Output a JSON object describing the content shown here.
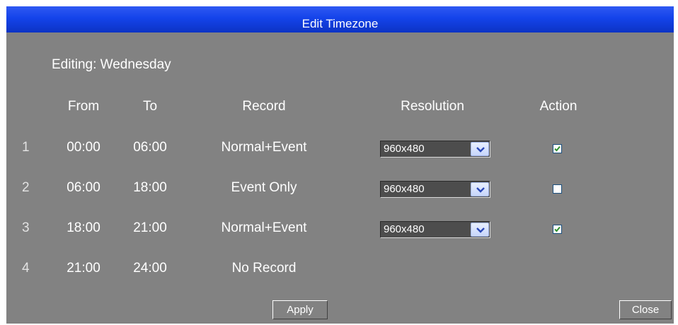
{
  "dialog": {
    "title": "Edit Timezone",
    "editing_label": "Editing: Wednesday"
  },
  "columns": {
    "from": "From",
    "to": "To",
    "record": "Record",
    "resolution": "Resolution",
    "action": "Action"
  },
  "rows": [
    {
      "num": "1",
      "from": "00:00",
      "to": "06:00",
      "record": "Normal+Event",
      "resolution": "960x480",
      "action_checked": true
    },
    {
      "num": "2",
      "from": "06:00",
      "to": "18:00",
      "record": "Event Only",
      "resolution": "960x480",
      "action_checked": false
    },
    {
      "num": "3",
      "from": "18:00",
      "to": "21:00",
      "record": "Normal+Event",
      "resolution": "960x480",
      "action_checked": true
    },
    {
      "num": "4",
      "from": "21:00",
      "to": "24:00",
      "record": "No Record"
    }
  ],
  "buttons": {
    "apply": "Apply",
    "close": "Close"
  },
  "colors": {
    "title_bar": "#1443ea",
    "dialog_bg": "#828282",
    "check_mark": "#2e8f2e"
  }
}
